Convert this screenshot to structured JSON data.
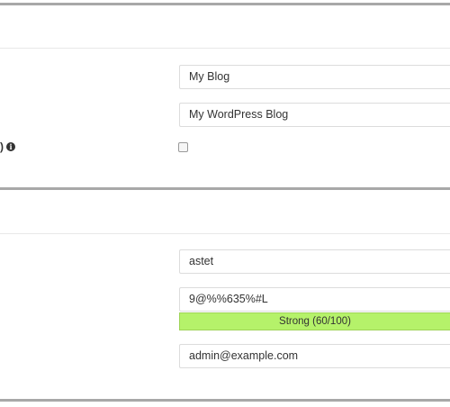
{
  "site_settings": {
    "partial_label_fragment": ")",
    "site_name": {
      "value": "My Blog"
    },
    "site_description": {
      "value": "My WordPress Blog"
    },
    "checkbox": {
      "checked": false
    }
  },
  "admin_account": {
    "username": {
      "value": "astet"
    },
    "password": {
      "value": "9@%%635%#L",
      "strength_label": "Strong (60/100)",
      "strength_percent": 60,
      "strength_color": "#b5f26a"
    },
    "email": {
      "value": "admin@example.com"
    }
  },
  "icons": {
    "info": "info-circle-icon",
    "info_glyph": "i"
  }
}
